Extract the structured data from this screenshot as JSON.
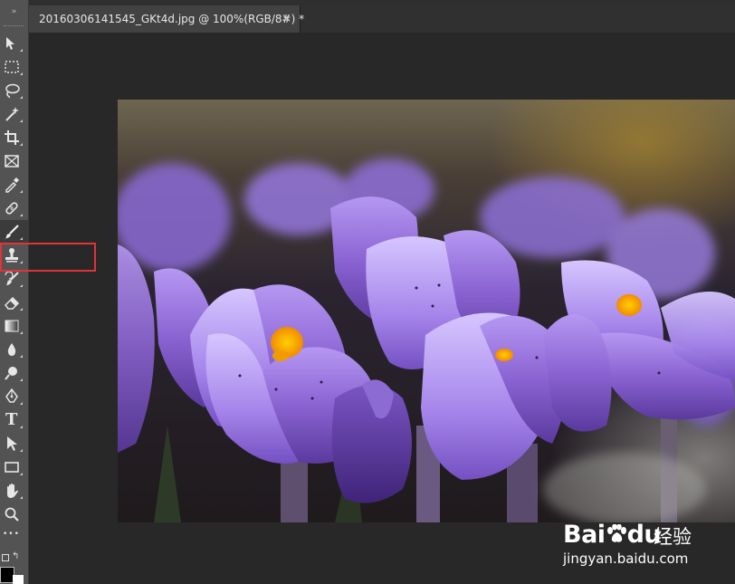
{
  "document": {
    "tab_title": "20160306141545_GKt4d.jpg @ 100%(RGB/8#) *",
    "close_glyph": "×"
  },
  "toolbar": {
    "collapse_glyph": "»",
    "tools": [
      {
        "name": "move-tool",
        "icon": "move-icon",
        "active": false
      },
      {
        "name": "marquee-tool",
        "icon": "marquee-icon",
        "active": false
      },
      {
        "name": "lasso-tool",
        "icon": "lasso-icon",
        "active": false
      },
      {
        "name": "magic-wand-tool",
        "icon": "magic-wand-icon",
        "active": false
      },
      {
        "name": "crop-tool",
        "icon": "crop-icon",
        "active": false
      },
      {
        "name": "frame-tool",
        "icon": "frame-icon",
        "active": false
      },
      {
        "name": "eyedropper-tool",
        "icon": "eyedropper-icon",
        "active": false
      },
      {
        "name": "healing-brush-tool",
        "icon": "bandage-icon",
        "active": false
      },
      {
        "name": "brush-tool",
        "icon": "brush-icon",
        "active": true
      },
      {
        "name": "clone-stamp-tool",
        "icon": "stamp-icon",
        "active": false
      },
      {
        "name": "history-brush-tool",
        "icon": "history-brush-icon",
        "active": false
      },
      {
        "name": "eraser-tool",
        "icon": "eraser-icon",
        "active": false
      },
      {
        "name": "gradient-tool",
        "icon": "gradient-icon",
        "active": false
      },
      {
        "name": "blur-tool",
        "icon": "drop-icon",
        "active": false
      },
      {
        "name": "dodge-tool",
        "icon": "dodge-icon",
        "active": false
      },
      {
        "name": "pen-tool",
        "icon": "pen-icon",
        "active": false
      },
      {
        "name": "type-tool",
        "icon": "type-icon",
        "active": false
      },
      {
        "name": "path-selection-tool",
        "icon": "arrow-icon",
        "active": false
      },
      {
        "name": "rectangle-tool",
        "icon": "rectangle-icon",
        "active": false
      },
      {
        "name": "hand-tool",
        "icon": "hand-icon",
        "active": false
      },
      {
        "name": "zoom-tool",
        "icon": "magnifier-icon",
        "active": false
      },
      {
        "name": "more-tools",
        "icon": "ellipsis-icon",
        "active": false
      }
    ],
    "type_glyph": "T",
    "more_glyph": "•••",
    "swap_glyph": "↰",
    "foreground_color": "#000000",
    "background_color": "#ffffff"
  },
  "annotation": {
    "highlight_color": "#e0333a",
    "highlighted_tool": "clone-stamp-tool"
  },
  "watermark": {
    "logo": "Bai du",
    "logo_parts": [
      "Bai",
      "du"
    ],
    "cn": "经验",
    "url": "jingyan.baidu.com"
  },
  "colors": {
    "toolbar_bg": "#535353",
    "canvas_bg": "#282828",
    "tab_bg": "#424242",
    "petal_purple": "#8a63d2",
    "stamen_orange": "#f5a000"
  }
}
